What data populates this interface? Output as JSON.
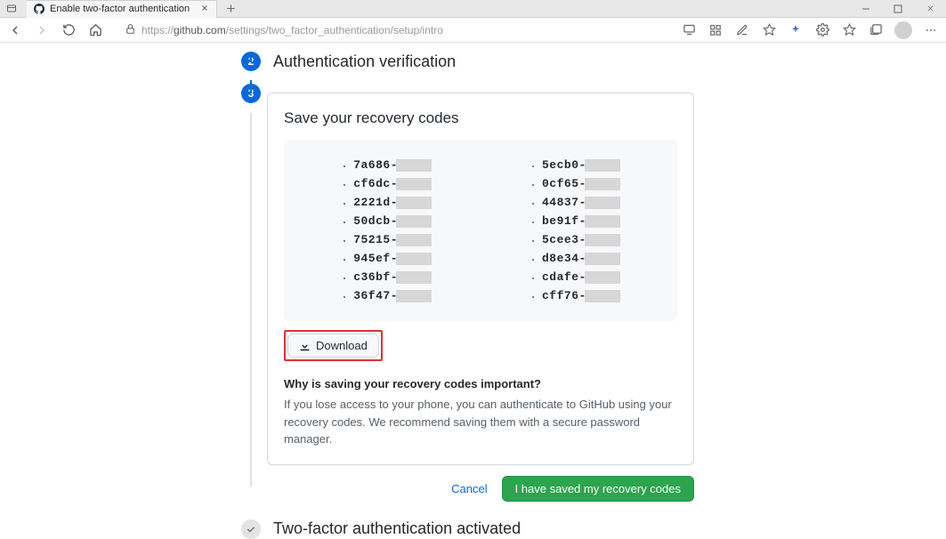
{
  "browser": {
    "tab_title": "Enable two-factor authentication",
    "url_prefix": "https://",
    "url_host": "github.com",
    "url_path": "/settings/two_factor_authentication/setup/intro"
  },
  "steps": {
    "step2": {
      "num": "2",
      "title": "Authentication verification"
    },
    "step3": {
      "num": "3"
    },
    "final": {
      "title": "Two-factor authentication activated"
    }
  },
  "card": {
    "heading": "Save your recovery codes",
    "download_label": "Download",
    "info_title": "Why is saving your recovery codes important?",
    "info_body": "If you lose access to your phone, you can authenticate to GitHub using your recovery codes. We recommend saving them with a secure password manager."
  },
  "codes_left": [
    "7a686-",
    "cf6dc-",
    "2221d-",
    "50dcb-",
    "75215-",
    "945ef-",
    "c36bf-",
    "36f47-"
  ],
  "codes_right": [
    "5ecb0-",
    "0cf65-",
    "44837-",
    "be91f-",
    "5cee3-",
    "d8e34-",
    "cdafe-",
    "cff76-"
  ],
  "actions": {
    "cancel": "Cancel",
    "confirm": "I have saved my recovery codes"
  }
}
